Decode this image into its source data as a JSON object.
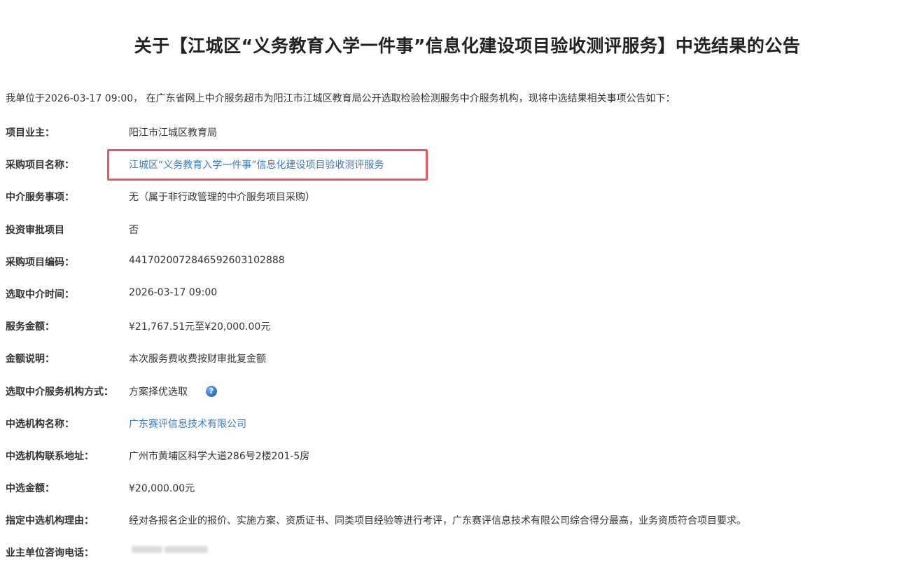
{
  "title": "关于【江城区“义务教育入学一件事”信息化建设项目验收测评服务】中选结果的公告",
  "intro": "我单位于2026-03-17 09:00， 在广东省网上中介服务超市为阳江市江城区教育局公开选取检验检测服务中介服务机构，现将中选结果相关事项公告如下：",
  "rows": [
    {
      "label": "项目业主：",
      "value": "阳江市江城区教育局"
    },
    {
      "label": "采购项目名称：",
      "value": "江城区“义务教育入学一件事”信息化建设项目验收测评服务"
    },
    {
      "label": "中介服务事项：",
      "value": "无（属于非行政管理的中介服务项目采购）"
    },
    {
      "label": "投资审批项目",
      "value": "否"
    },
    {
      "label": "采购项目编码：",
      "value": "441702007284659260310288 8"
    },
    {
      "label": "选取中介时间：",
      "value": "2026-03-17 09:00"
    },
    {
      "label": "服务金额：",
      "value": "¥21,767.51元至¥20,000.00元"
    },
    {
      "label": "金额说明：",
      "value": "本次服务费收费按财审批复金额"
    },
    {
      "label": "选取中介服务机构方式：",
      "value": "方案择优选取"
    },
    {
      "label": "中选机构名称：",
      "value": "广东赛评信息技术有限公司"
    },
    {
      "label": "中选机构联系地址：",
      "value": "广州市黄埔区科学大道286号2楼201-5房"
    },
    {
      "label": "中选金额：",
      "value": "¥20,000.00元"
    },
    {
      "label": "指定中选机构理由：",
      "value": "经对各报名企业的报价、实施方案、资质证书、同类项目经验等进行考评，广东赛评信息技术有限公司综合得分最高，业务资质符合项目要求。"
    },
    {
      "label": "业主单位咨询电话：",
      "value": ""
    }
  ],
  "help_icon_glyph": "?",
  "colors": {
    "link": "#3b78c4",
    "highlight_border": "#e25a5f",
    "text": "#333333"
  }
}
